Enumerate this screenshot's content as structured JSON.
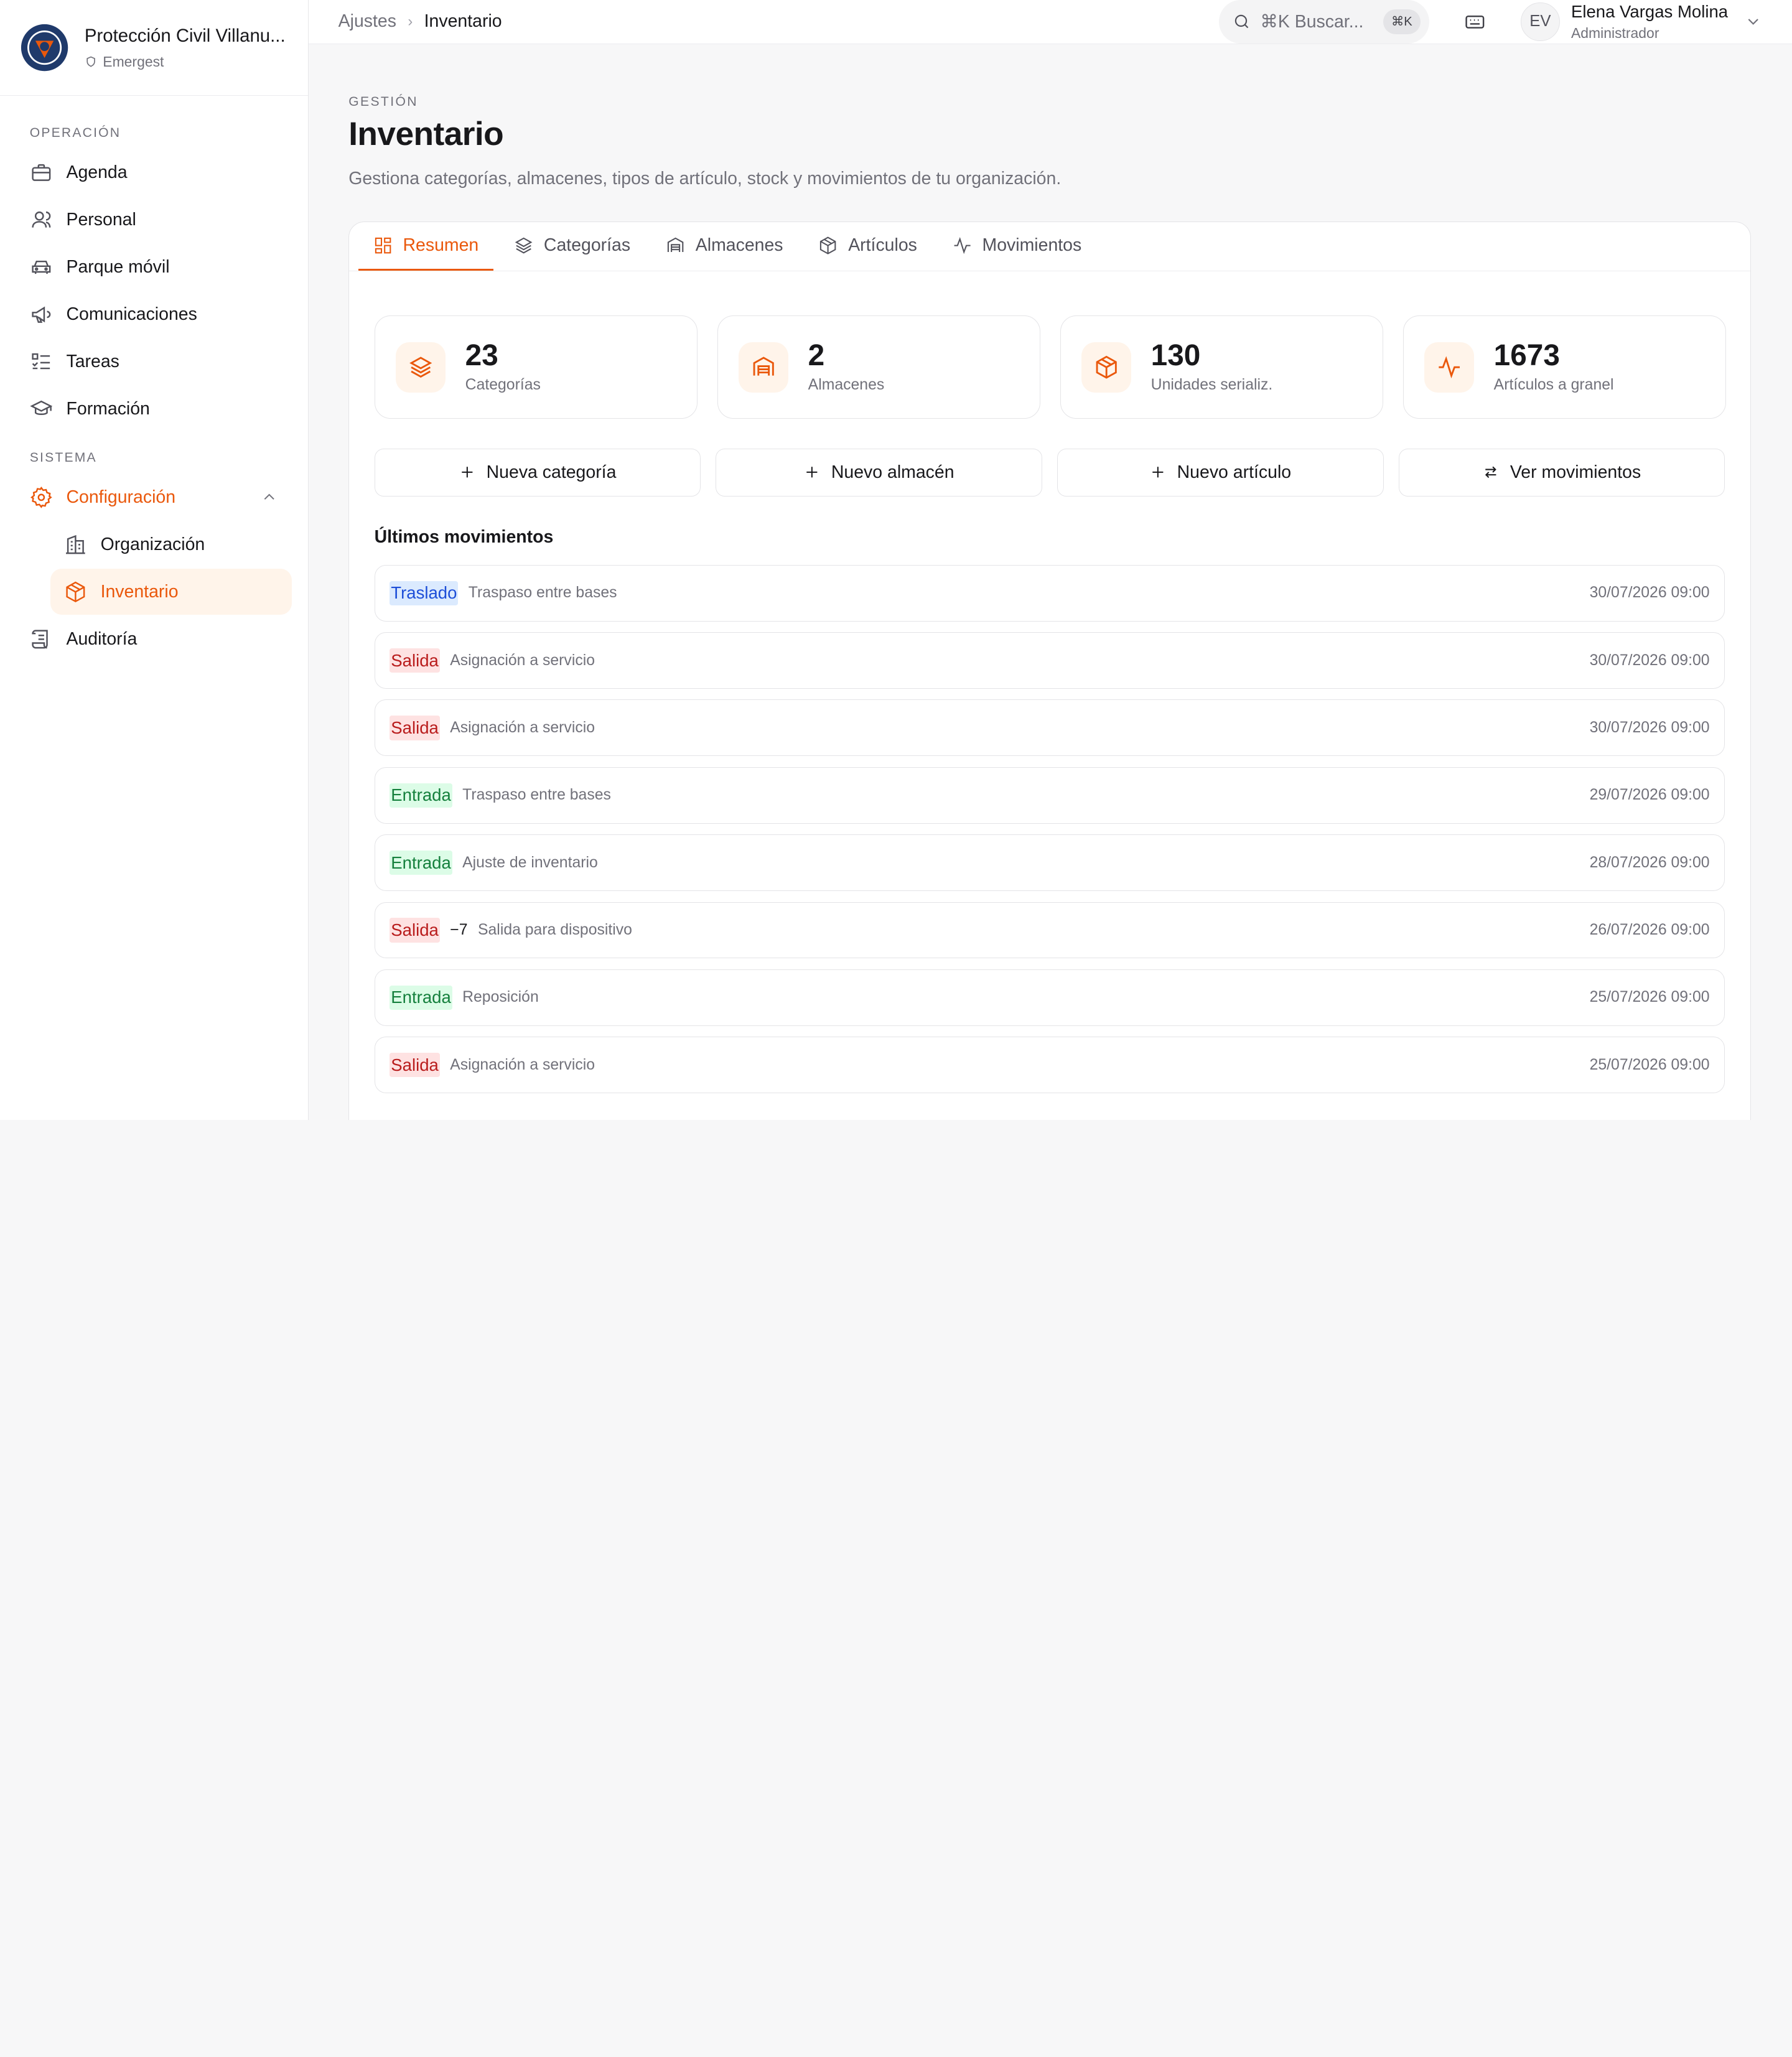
{
  "brand": {
    "name": "Protección Civil Villanu...",
    "subtitle": "Emergest",
    "colors": {
      "navy": "#1f3a6b",
      "orange": "#ea580c"
    }
  },
  "sidebar": {
    "section_operation": "OPERACIÓN",
    "section_system": "SISTEMA",
    "items": [
      {
        "label": "Agenda",
        "icon": "briefcase-icon"
      },
      {
        "label": "Personal",
        "icon": "user-icon"
      },
      {
        "label": "Parque móvil",
        "icon": "car-icon"
      },
      {
        "label": "Comunicaciones",
        "icon": "megaphone-icon"
      },
      {
        "label": "Tareas",
        "icon": "checklist-icon"
      },
      {
        "label": "Formación",
        "icon": "graduation-cap-icon"
      }
    ],
    "config": {
      "label": "Configuración",
      "icon": "gear-icon",
      "expanded": true
    },
    "sub_items": [
      {
        "label": "Organización",
        "icon": "building-icon"
      },
      {
        "label": "Inventario",
        "icon": "package-icon",
        "active": true
      }
    ],
    "audit": {
      "label": "Auditoría",
      "icon": "scroll-icon"
    }
  },
  "topbar": {
    "breadcrumb_parent": "Ajustes",
    "breadcrumb_current": "Inventario",
    "search_placeholder": "⌘K Buscar...",
    "search_kbd": "⌘K",
    "user_initials": "EV",
    "user_name": "Elena Vargas Molina",
    "user_role": "Administrador"
  },
  "page": {
    "eyebrow": "GESTIÓN",
    "title": "Inventario",
    "description": "Gestiona categorías, almacenes, tipos de artículo, stock y movimientos de tu organización."
  },
  "tabs": [
    {
      "label": "Resumen",
      "icon": "grid-icon",
      "active": true
    },
    {
      "label": "Categorías",
      "icon": "layers-icon"
    },
    {
      "label": "Almacenes",
      "icon": "warehouse-icon"
    },
    {
      "label": "Artículos",
      "icon": "package-icon"
    },
    {
      "label": "Movimientos",
      "icon": "activity-icon"
    }
  ],
  "stats": [
    {
      "value": "23",
      "label": "Categorías",
      "icon": "layers-icon"
    },
    {
      "value": "2",
      "label": "Almacenes",
      "icon": "warehouse-icon"
    },
    {
      "value": "130",
      "label": "Unidades serializ.",
      "icon": "package-icon"
    },
    {
      "value": "1673",
      "label": "Artículos a granel",
      "icon": "activity-icon"
    }
  ],
  "actions": [
    {
      "label": "Nueva categoría",
      "icon": "plus-icon"
    },
    {
      "label": "Nuevo almacén",
      "icon": "plus-icon"
    },
    {
      "label": "Nuevo artículo",
      "icon": "plus-icon"
    },
    {
      "label": "Ver movimientos",
      "icon": "arrows-swap-icon"
    }
  ],
  "recent": {
    "title": "Últimos movimientos",
    "items": [
      {
        "type": "Traslado",
        "kind": "traslado",
        "qty": "",
        "desc": "Traspaso entre bases",
        "date": "30/07/2026 09:00"
      },
      {
        "type": "Salida",
        "kind": "salida",
        "qty": "",
        "desc": "Asignación a servicio",
        "date": "30/07/2026 09:00"
      },
      {
        "type": "Salida",
        "kind": "salida",
        "qty": "",
        "desc": "Asignación a servicio",
        "date": "30/07/2026 09:00"
      },
      {
        "type": "Entrada",
        "kind": "entrada",
        "qty": "",
        "desc": "Traspaso entre bases",
        "date": "29/07/2026 09:00"
      },
      {
        "type": "Entrada",
        "kind": "entrada",
        "qty": "",
        "desc": "Ajuste de inventario",
        "date": "28/07/2026 09:00"
      },
      {
        "type": "Salida",
        "kind": "salida",
        "qty": "−7",
        "desc": "Salida para dispositivo",
        "date": "26/07/2026 09:00"
      },
      {
        "type": "Entrada",
        "kind": "entrada",
        "qty": "",
        "desc": "Reposición",
        "date": "25/07/2026 09:00"
      },
      {
        "type": "Salida",
        "kind": "salida",
        "qty": "",
        "desc": "Asignación a servicio",
        "date": "25/07/2026 09:00"
      }
    ]
  }
}
